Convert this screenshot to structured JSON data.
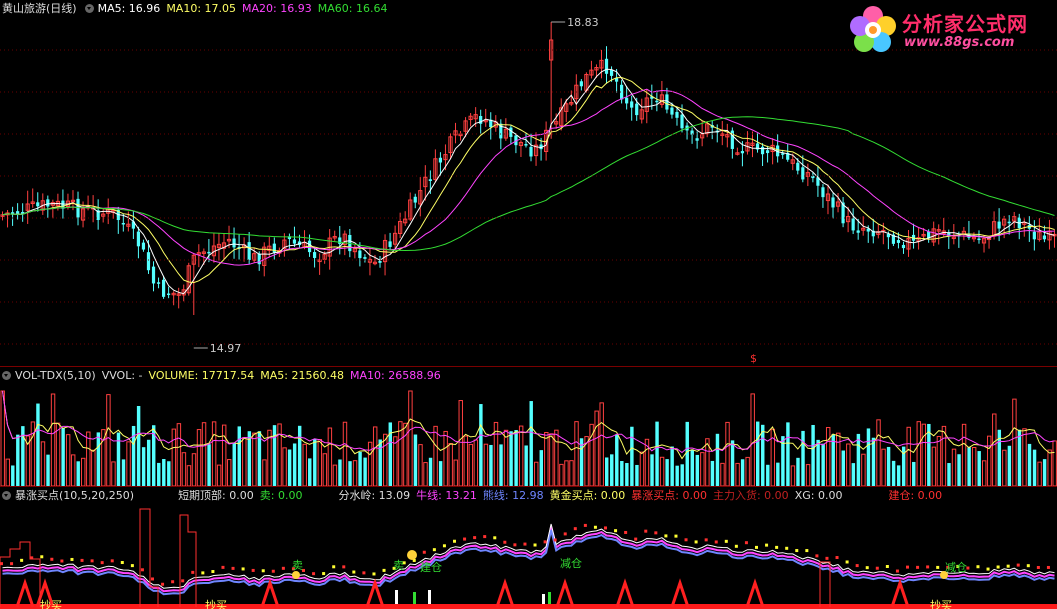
{
  "price_panel": {
    "stock": "黄山旅游(日线)",
    "ma_labels": [
      {
        "text": "MA5: 16.96",
        "color": "#ffffff"
      },
      {
        "text": "MA10: 17.05",
        "color": "#ffff66"
      },
      {
        "text": "MA20: 16.93",
        "color": "#ff44ff"
      },
      {
        "text": "MA60: 16.64",
        "color": "#33dd33"
      }
    ],
    "high_label": "18.83",
    "low_label": "14.97",
    "dollar_mark": "$"
  },
  "vol_panel": {
    "labels": [
      {
        "text": "VOL-TDX(5,10)",
        "color": "#dddddd"
      },
      {
        "text": "VVOL: -",
        "color": "#dddddd"
      },
      {
        "text": "VOLUME: 17717.54",
        "color": "#ffff66"
      },
      {
        "text": "MA5: 21560.48",
        "color": "#ffff66"
      },
      {
        "text": "MA10: 26588.96",
        "color": "#ff44ff"
      }
    ]
  },
  "ind_panel": {
    "labels": [
      {
        "text": "暴涨买点(10,5,20,250)",
        "color": "#dddddd"
      },
      {
        "text": "短期顶部: 0.00",
        "color": "#dddddd"
      },
      {
        "text": "卖: 0.00",
        "color": "#33dd33"
      },
      {
        "text": "分水岭: 13.09",
        "color": "#dddddd"
      },
      {
        "text": "牛线: 13.21",
        "color": "#ff44ff"
      },
      {
        "text": "熊线: 12.98",
        "color": "#6f86ff"
      },
      {
        "text": "黄金买点: 0.00",
        "color": "#ffff66"
      },
      {
        "text": "暴涨买点: 0.00",
        "color": "#ff3030"
      },
      {
        "text": "主力入货: 0.00",
        "color": "#c02020"
      },
      {
        "text": "XG: 0.00",
        "color": "#dddddd"
      },
      {
        "text": "建仓: 0.00",
        "color": "#ff3030"
      }
    ],
    "markers": [
      "卖",
      "卖",
      "建仓",
      "减仓",
      "减仓",
      "抄买",
      "抄买",
      "抄买"
    ]
  },
  "logo": {
    "brand": "分析家公式网",
    "site": "www.88gs.com"
  },
  "colors": {
    "up": "#ff4040",
    "down": "#54ffff",
    "ma5": "#ffffff",
    "ma10": "#ffff66",
    "ma20": "#ff44ff",
    "ma60": "#33dd33",
    "separator": "#7a0000"
  }
}
